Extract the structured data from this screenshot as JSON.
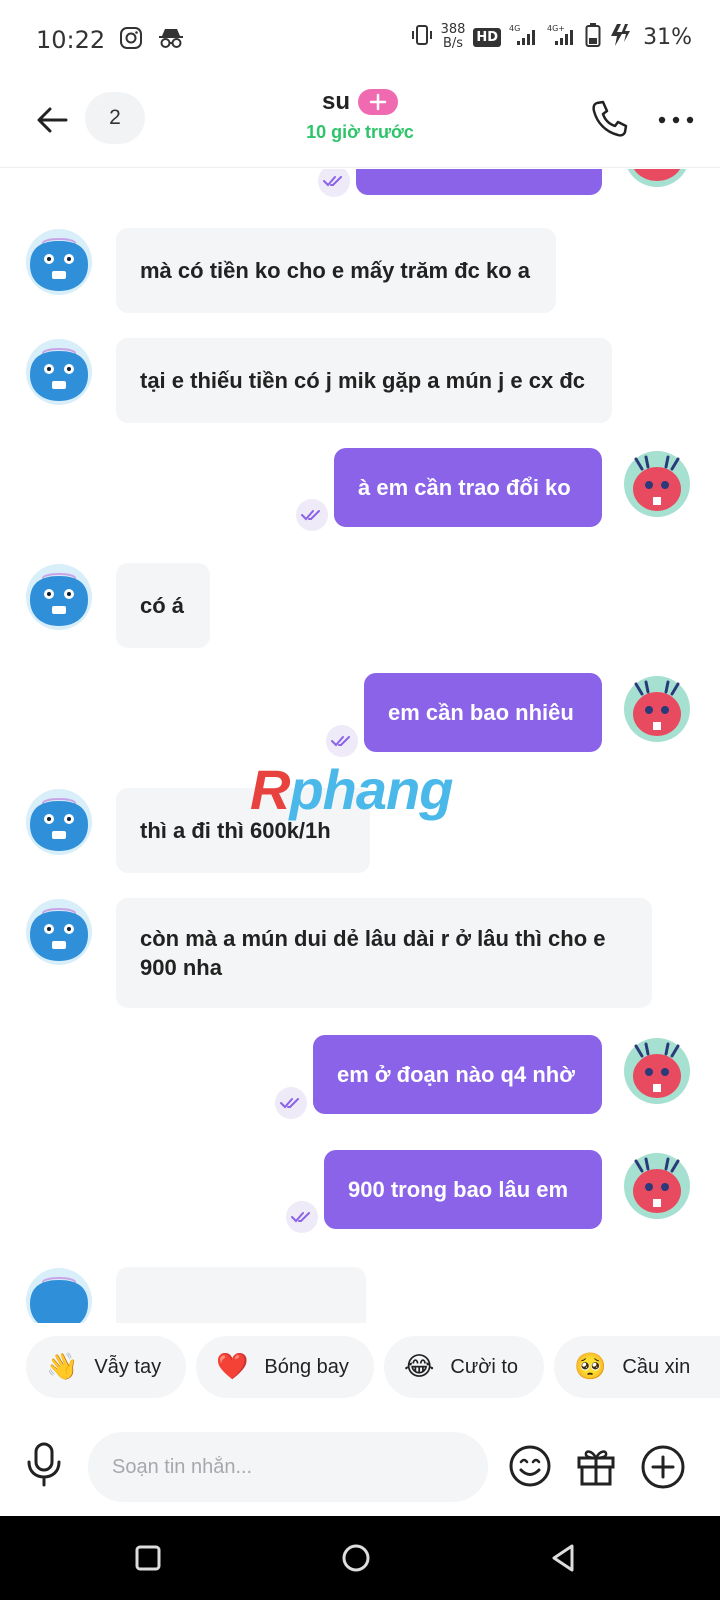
{
  "status_bar": {
    "time": "10:22",
    "net_rate_value": "388",
    "net_rate_unit": "B/s",
    "hd_label": "HD",
    "battery": "31%"
  },
  "header": {
    "unread_count": "2",
    "contact_name": "su",
    "last_seen": "10 giờ trước"
  },
  "colors": {
    "outgoing_bubble": "#8a63e8",
    "incoming_bubble": "#f4f5f7",
    "online_text": "#2ec46a",
    "plus_badge": "#f06ab2"
  },
  "messages": [
    {
      "dir": "in",
      "text": "mà có tiền ko cho e mấy trăm đc ko a"
    },
    {
      "dir": "in",
      "text": "tại e thiếu tiền có j mik gặp a mún j e cx đc"
    },
    {
      "dir": "out",
      "text": "à em cần trao đổi ko"
    },
    {
      "dir": "in",
      "text": "có á"
    },
    {
      "dir": "out",
      "text": "em cần bao nhiêu"
    },
    {
      "dir": "in",
      "text": "thì a đi thì 600k/1h"
    },
    {
      "dir": "in",
      "text": "còn mà a mún dui dẻ lâu dài r ở lâu thì cho e 900 nha"
    },
    {
      "dir": "out",
      "text": "em ở đoạn nào q4 nhờ"
    },
    {
      "dir": "out",
      "text": "900 trong bao lâu em"
    }
  ],
  "watermark": {
    "part1": "R",
    "part2": "phang"
  },
  "quick_reactions": [
    {
      "emoji": "👋",
      "label": "Vẫy tay"
    },
    {
      "emoji": "❤️",
      "label": "Bóng bay"
    },
    {
      "emoji": "😂",
      "label": "Cười to"
    },
    {
      "emoji": "🥺",
      "label": "Cầu xin"
    }
  ],
  "composer": {
    "placeholder": "Soạn tin nhắn..."
  }
}
